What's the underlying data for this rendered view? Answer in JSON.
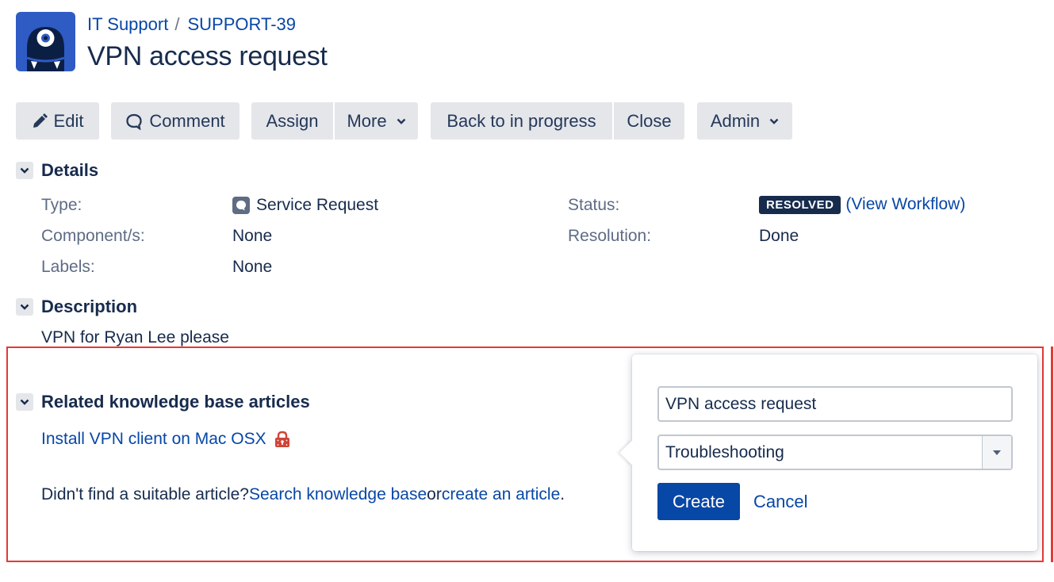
{
  "breadcrumb": {
    "project": "IT Support",
    "separator": "/",
    "issue_key": "SUPPORT-39"
  },
  "page_title": "VPN access request",
  "toolbar": {
    "edit": "Edit",
    "comment": "Comment",
    "assign": "Assign",
    "more": "More",
    "back_to_in_progress": "Back to in progress",
    "close": "Close",
    "admin": "Admin"
  },
  "details": {
    "heading": "Details",
    "type_label": "Type:",
    "type_value": "Service Request",
    "components_label": "Component/s:",
    "components_value": "None",
    "labels_label": "Labels:",
    "labels_value": "None",
    "status_label": "Status:",
    "status_value": "RESOLVED",
    "view_workflow_open": "(",
    "view_workflow": "View Workflow",
    "view_workflow_close": ")",
    "resolution_label": "Resolution:",
    "resolution_value": "Done"
  },
  "description": {
    "heading": "Description",
    "text": "VPN for Ryan Lee please"
  },
  "kb": {
    "heading": "Related knowledge base articles",
    "article_link": "Install VPN client on Mac OSX",
    "prompt": "Didn't find a suitable article?",
    "search_link": "Search knowledge base",
    "or_text": "or",
    "create_link": "create an article",
    "end_text": "."
  },
  "popup": {
    "title_value": "VPN access request",
    "template_value": "Troubleshooting",
    "create_label": "Create",
    "cancel_label": "Cancel"
  },
  "colors": {
    "primary": "#0747a6",
    "button_bg": "#e4e6ea",
    "lozenge_bg": "#172b4d",
    "highlight": "#e53935",
    "avatar_bg": "#2f5bc4",
    "lock": "#d04437"
  },
  "icons": {
    "edit": "pencil-icon",
    "comment": "speech-bubble-icon",
    "dropdown": "chevron-down-icon",
    "section_toggle": "chevron-down-icon",
    "issue_type": "service-request-icon",
    "restricted": "lock-icon",
    "project": "project-avatar"
  }
}
